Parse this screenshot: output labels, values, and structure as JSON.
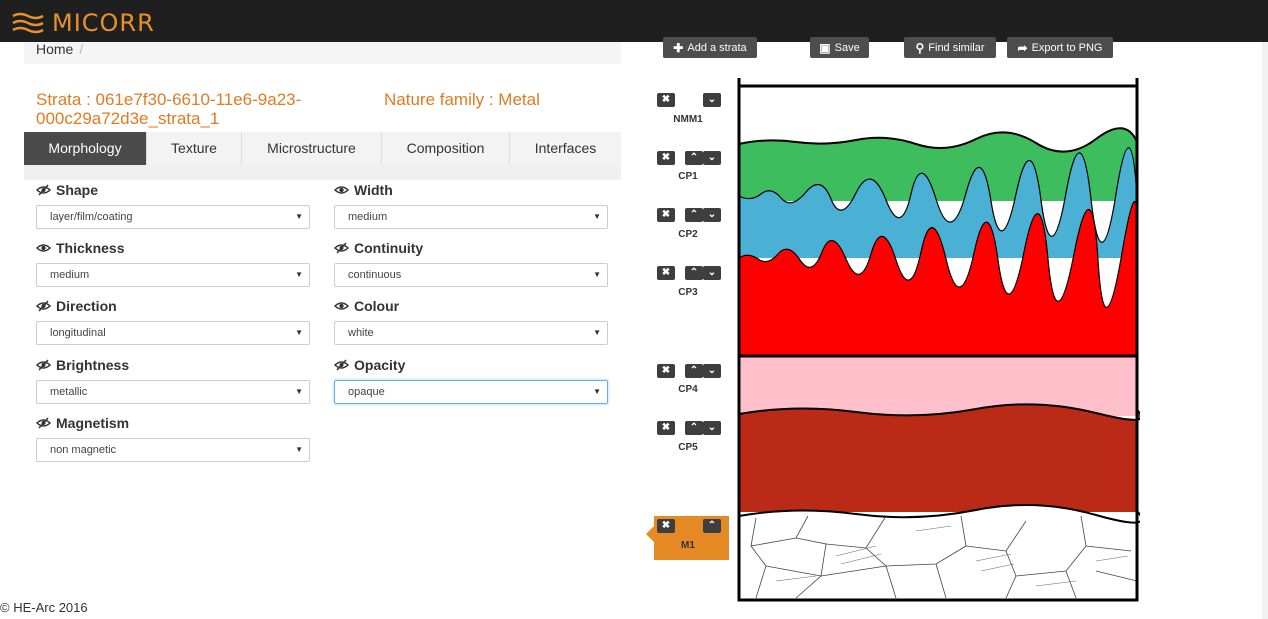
{
  "header": {
    "logo_text": "MICORR"
  },
  "breadcrumb": {
    "home": "Home",
    "separator": "/"
  },
  "strata": {
    "title": "Strata : 061e7f30-6610-11e6-9a23-000c29a72d3e_strata_1",
    "nature_family": "Nature family : Metal"
  },
  "tabs": [
    {
      "label": "Morphology",
      "active": true
    },
    {
      "label": "Texture",
      "active": false
    },
    {
      "label": "Microstructure",
      "active": false
    },
    {
      "label": "Composition",
      "active": false
    },
    {
      "label": "Interfaces",
      "active": false
    }
  ],
  "form": {
    "shape": {
      "label": "Shape",
      "value": "layer/film/coating",
      "icon": "eye-slash-icon"
    },
    "width": {
      "label": "Width",
      "value": "medium",
      "icon": "eye-icon"
    },
    "thickness": {
      "label": "Thickness",
      "value": "medium",
      "icon": "eye-icon"
    },
    "continuity": {
      "label": "Continuity",
      "value": "continuous",
      "icon": "eye-slash-icon"
    },
    "direction": {
      "label": "Direction",
      "value": "longitudinal",
      "icon": "eye-slash-icon"
    },
    "colour": {
      "label": "Colour",
      "value": "white",
      "icon": "eye-icon"
    },
    "brightness": {
      "label": "Brightness",
      "value": "metallic",
      "icon": "eye-slash-icon"
    },
    "opacity": {
      "label": "Opacity",
      "value": "opaque",
      "icon": "eye-slash-icon"
    },
    "magnetism": {
      "label": "Magnetism",
      "value": "non magnetic",
      "icon": "eye-slash-icon"
    }
  },
  "toolbar": {
    "add": "Add a strata",
    "save": "Save",
    "find": "Find similar",
    "export": "Export to PNG"
  },
  "strata_list": [
    {
      "label": "NMM1",
      "color": "#ffffff"
    },
    {
      "label": "CP1",
      "color": "#3dbd5d"
    },
    {
      "label": "CP2",
      "color": "#4ab0d4"
    },
    {
      "label": "CP3",
      "color": "#ff0000"
    },
    {
      "label": "CP4",
      "color": "#ffc0cb"
    },
    {
      "label": "CP5",
      "color": "#bb2a17"
    },
    {
      "label": "M1",
      "color": "#ffffff"
    }
  ],
  "footer": {
    "copyright": "© HE-Arc 2016"
  },
  "colors": {
    "accent": "#e07b22",
    "header_bg": "#1f1f1f",
    "active_tab": "#4a4a4a",
    "selected_item": "#e58a24"
  }
}
